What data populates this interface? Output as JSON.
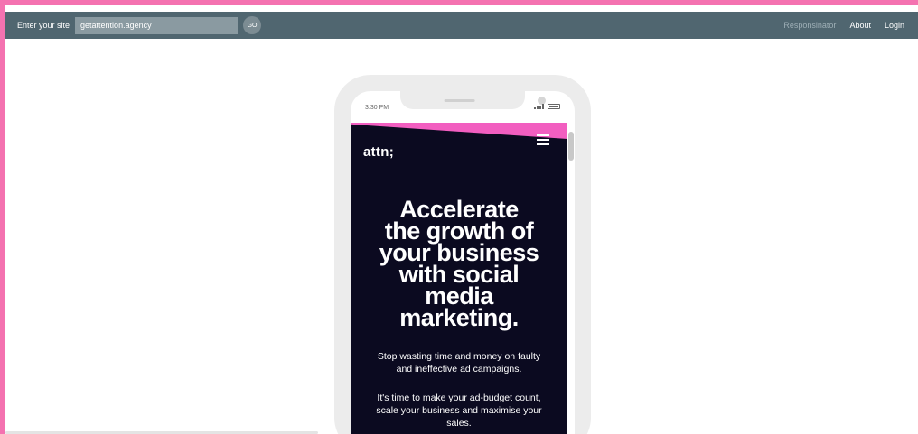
{
  "topbar": {
    "site_label": "Enter your site",
    "site_value": "getattention.agency",
    "go_label": "GO",
    "nav": {
      "responsinator": "Responsinator",
      "about": "About",
      "login": "Login"
    }
  },
  "colors": {
    "page_border": "#f472b0",
    "topbar_bg": "#506670",
    "site_bg": "#0b0a20",
    "site_accent": "#f25ec0"
  },
  "phone": {
    "status_time": "3:30 PM",
    "icons": {
      "signal": "signal-icon",
      "battery": "battery-icon",
      "menu": "hamburger-menu-icon"
    },
    "site": {
      "logo": "attn;",
      "headline_lines": [
        "Accelerate",
        "the growth of",
        "your business",
        "with social",
        "media",
        "marketing."
      ],
      "paragraph1_lines": [
        "Stop wasting time and money on faulty",
        "and ineffective ad campaigns."
      ],
      "paragraph2_lines": [
        "It's time to make your ad-budget count,",
        "scale your business and maximise your",
        "sales."
      ]
    }
  }
}
